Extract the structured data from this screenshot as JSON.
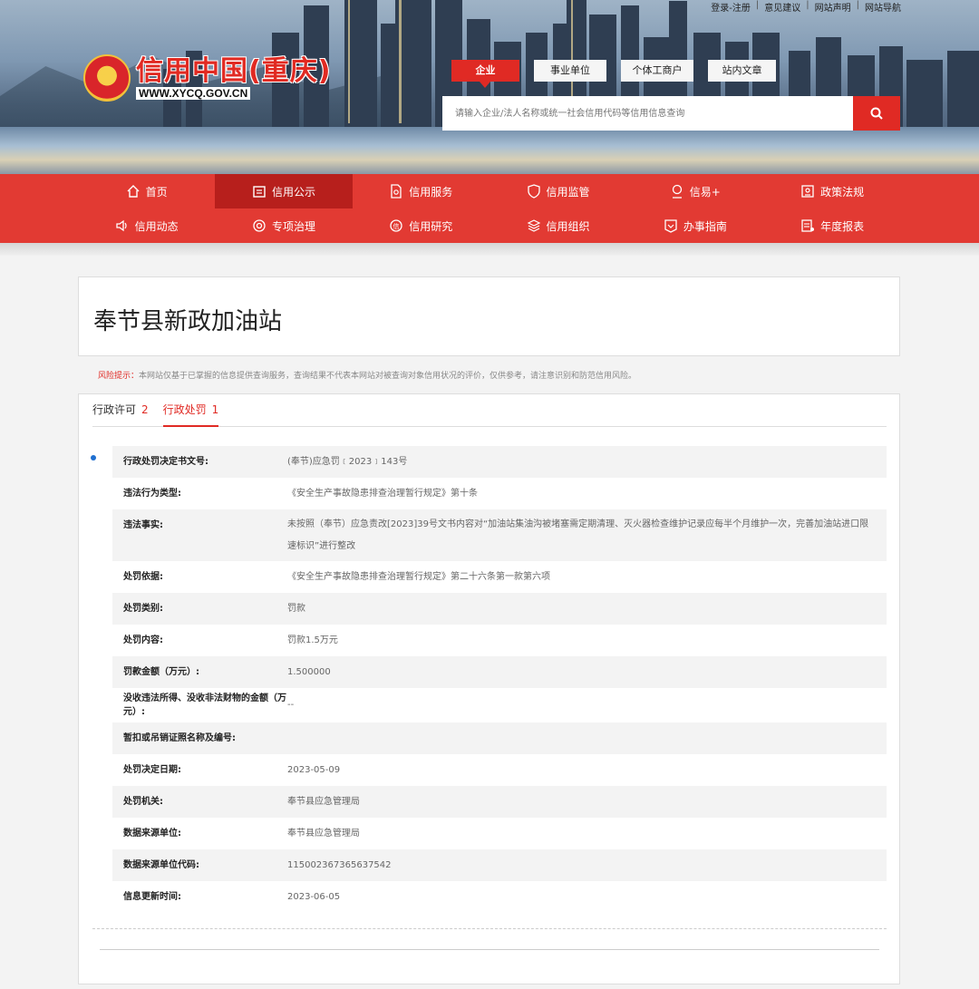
{
  "top_links": [
    "登录-注册",
    "意见建议",
    "网站声明",
    "网站导航"
  ],
  "logo": {
    "title": "信用中国(重庆)",
    "url": "WWW.XYCQ.GOV.CN"
  },
  "search": {
    "tabs": [
      "企业",
      "事业单位",
      "个体工商户",
      "站内文章"
    ],
    "placeholder": "请输入企业/法人名称或统一社会信用代码等信用信息查询"
  },
  "nav": {
    "row1": [
      "首页",
      "信用公示",
      "信用服务",
      "信用监管",
      "信易+",
      "政策法规"
    ],
    "row2": [
      "信用动态",
      "专项治理",
      "信用研究",
      "信用组织",
      "办事指南",
      "年度报表"
    ]
  },
  "company": {
    "name": "奉节县新政加油站"
  },
  "risk": {
    "label": "风险提示：",
    "text": "本网站仅基于已掌握的信息提供查询服务，查询结果不代表本网站对被查询对象信用状况的评价，仅供参考，请注意识别和防范信用风险。"
  },
  "tabs": [
    {
      "label": "行政许可",
      "count": "2"
    },
    {
      "label": "行政处罚",
      "count": "1"
    }
  ],
  "record": [
    {
      "key": "行政处罚决定书文号:",
      "value": "(奉节)应急罚﹝2023﹞143号"
    },
    {
      "key": "违法行为类型:",
      "value": "《安全生产事故隐患排查治理暂行规定》第十条"
    },
    {
      "key": "违法事实:",
      "value": "未按照（奉节）应急责改[2023]39号文书内容对“加油站集油沟被堵塞需定期清理、灭火器检查维护记录应每半个月维护一次，完善加油站进口限速标识”进行整改"
    },
    {
      "key": "处罚依据:",
      "value": "《安全生产事故隐患排查治理暂行规定》第二十六条第一款第六项"
    },
    {
      "key": "处罚类别:",
      "value": "罚款"
    },
    {
      "key": "处罚内容:",
      "value": "罚款1.5万元"
    },
    {
      "key": "罚款金额（万元）:",
      "value": "1.500000"
    },
    {
      "key": "没收违法所得、没收非法财物的金额（万元）:",
      "value": "--"
    },
    {
      "key": "暂扣或吊销证照名称及编号:",
      "value": ""
    },
    {
      "key": "处罚决定日期:",
      "value": "2023-05-09"
    },
    {
      "key": "处罚机关:",
      "value": "奉节县应急管理局"
    },
    {
      "key": "数据来源单位:",
      "value": "奉节县应急管理局"
    },
    {
      "key": "数据来源单位代码:",
      "value": "115002367365637542"
    },
    {
      "key": "信息更新时间:",
      "value": "2023-06-05"
    }
  ],
  "colors": {
    "brand_red": "#e02a24",
    "nav_red": "#e23a33",
    "nav_active": "#b71f1c",
    "bullet_blue": "#1f6fd0"
  }
}
